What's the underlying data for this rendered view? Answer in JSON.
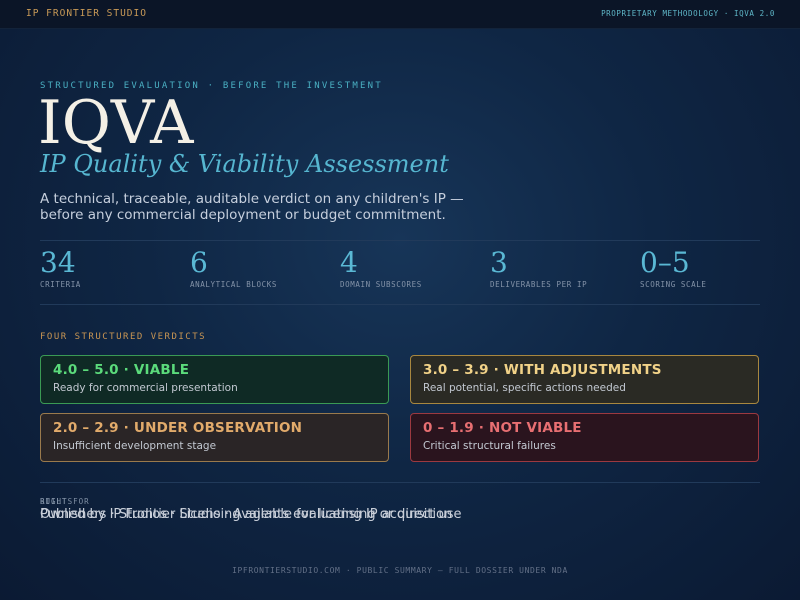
{
  "header": {
    "brand": "IP FRONTIER STUDIO",
    "methodology": "PROPRIETARY METHODOLOGY · IQVA 2.0"
  },
  "hero": {
    "eyebrow": "STRUCTURED EVALUATION · BEFORE THE INVESTMENT",
    "title": "IQVA",
    "subtitle": "IP Quality & Viability Assessment",
    "intro_line_1": "A technical, traceable, auditable verdict on any children's IP —",
    "intro_line_2": "before any commercial deployment or budget commitment."
  },
  "stats": [
    {
      "value": "34",
      "label": "CRITERIA"
    },
    {
      "value": "6",
      "label": "ANALYTICAL BLOCKS"
    },
    {
      "value": "4",
      "label": "DOMAIN SUBSCORES"
    },
    {
      "value": "3",
      "label": "DELIVERABLES PER IP"
    },
    {
      "value": "0–5",
      "label": "SCORING SCALE"
    }
  ],
  "verdicts": {
    "heading": "FOUR STRUCTURED VERDICTS",
    "items": [
      {
        "title": "4.0 – 5.0 · VIABLE",
        "description": "Ready for commercial presentation",
        "color": "#5bdb7b",
        "border": "#3a9a54",
        "background": "#0f2a25"
      },
      {
        "title": "3.0 – 3.9 · WITH ADJUSTMENTS",
        "description": "Real potential, specific actions needed",
        "color": "#f1d288",
        "border": "#a8873f",
        "background": "#2a2a24"
      },
      {
        "title": "2.0 – 2.9 · UNDER OBSERVATION",
        "description": "Insufficient development stage",
        "color": "#e2ab6b",
        "border": "#9a7a4c",
        "background": "#2a2526"
      },
      {
        "title": "0 – 1.9 · NOT VIABLE",
        "description": "Critical structural failures",
        "color": "#e86f72",
        "border": "#9c3940",
        "background": "#2a141e"
      }
    ]
  },
  "footer": {
    "rights_label": "RIGHTS",
    "rights_text": "Owned by IP Frontier Studio · Available for licensing or direct use",
    "built_for_label": "BUILT FOR",
    "built_for_text": "Publishers · Studios · Licensing agents evaluating IP acquisition",
    "bottom": "IPFRONTIERSTUDIO.COM · PUBLIC SUMMARY — FULL DOSSIER UNDER NDA"
  }
}
